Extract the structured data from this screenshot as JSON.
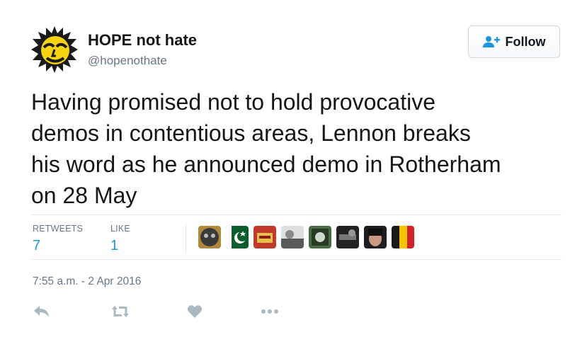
{
  "author": {
    "name": "HOPE not hate",
    "handle": "@hopenothate"
  },
  "follow_button": {
    "label": "Follow",
    "icon": "add-user-icon"
  },
  "tweet": {
    "text_lines": [
      "Having promised not to hold provocative",
      "demos in contentious areas, Lennon breaks",
      "his word as he announced demo in Rotherham",
      "on 28 May"
    ],
    "timestamp": "7:55 a.m. - 2 Apr 2016"
  },
  "stats": {
    "retweets_label": "RETWEETS",
    "retweets_count": "7",
    "likes_label": "LIKE",
    "likes_count": "1"
  },
  "actions": [
    "reply-icon",
    "retweet-icon",
    "like-heart-icon",
    "more-icon"
  ],
  "colors": {
    "accent": "#1b95e0",
    "secondary_text": "#657786",
    "divider": "#e1e8ed"
  }
}
